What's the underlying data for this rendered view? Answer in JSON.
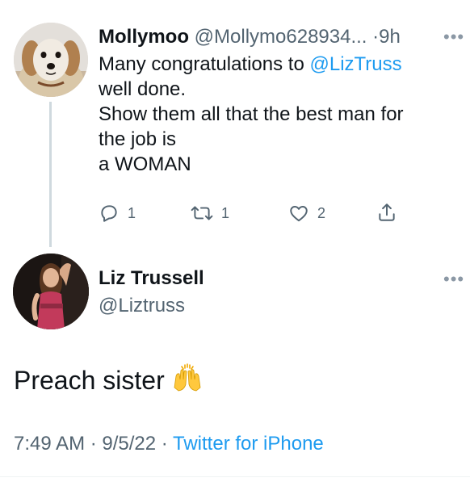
{
  "reply": {
    "display_name": "Mollymoo",
    "handle": "@Mollymo628934...",
    "separator": "·",
    "time": "9h",
    "text_lines": [
      {
        "prefix": "Many congratulations to ",
        "mention": "@LizTruss"
      },
      "well done.",
      "Show them all that the best man for",
      "the job is",
      "a WOMAN"
    ],
    "line1_prefix": "Many congratulations to ",
    "line1_mention": "@LizTruss",
    "line2": "well done.",
    "line3": "Show them all that the best man for",
    "line4": "the job is",
    "line5": "a WOMAN",
    "reply_count": "1",
    "retweet_count": "1",
    "like_count": "2",
    "avatar_icon": "dog-avatar"
  },
  "main_tweet": {
    "display_name": "Liz Trussell",
    "handle": "@Liztruss",
    "text": "Preach sister",
    "emoji_icon": "raising-hands-emoji",
    "timestamp": "7:49 AM · 9/5/22 · ",
    "source": "Twitter for iPhone",
    "avatar_icon": "woman-avatar"
  },
  "colors": {
    "link": "#1d9bf0",
    "secondary_text": "#536471",
    "primary_text": "#0f1419",
    "thread_line": "#cfd9de"
  }
}
